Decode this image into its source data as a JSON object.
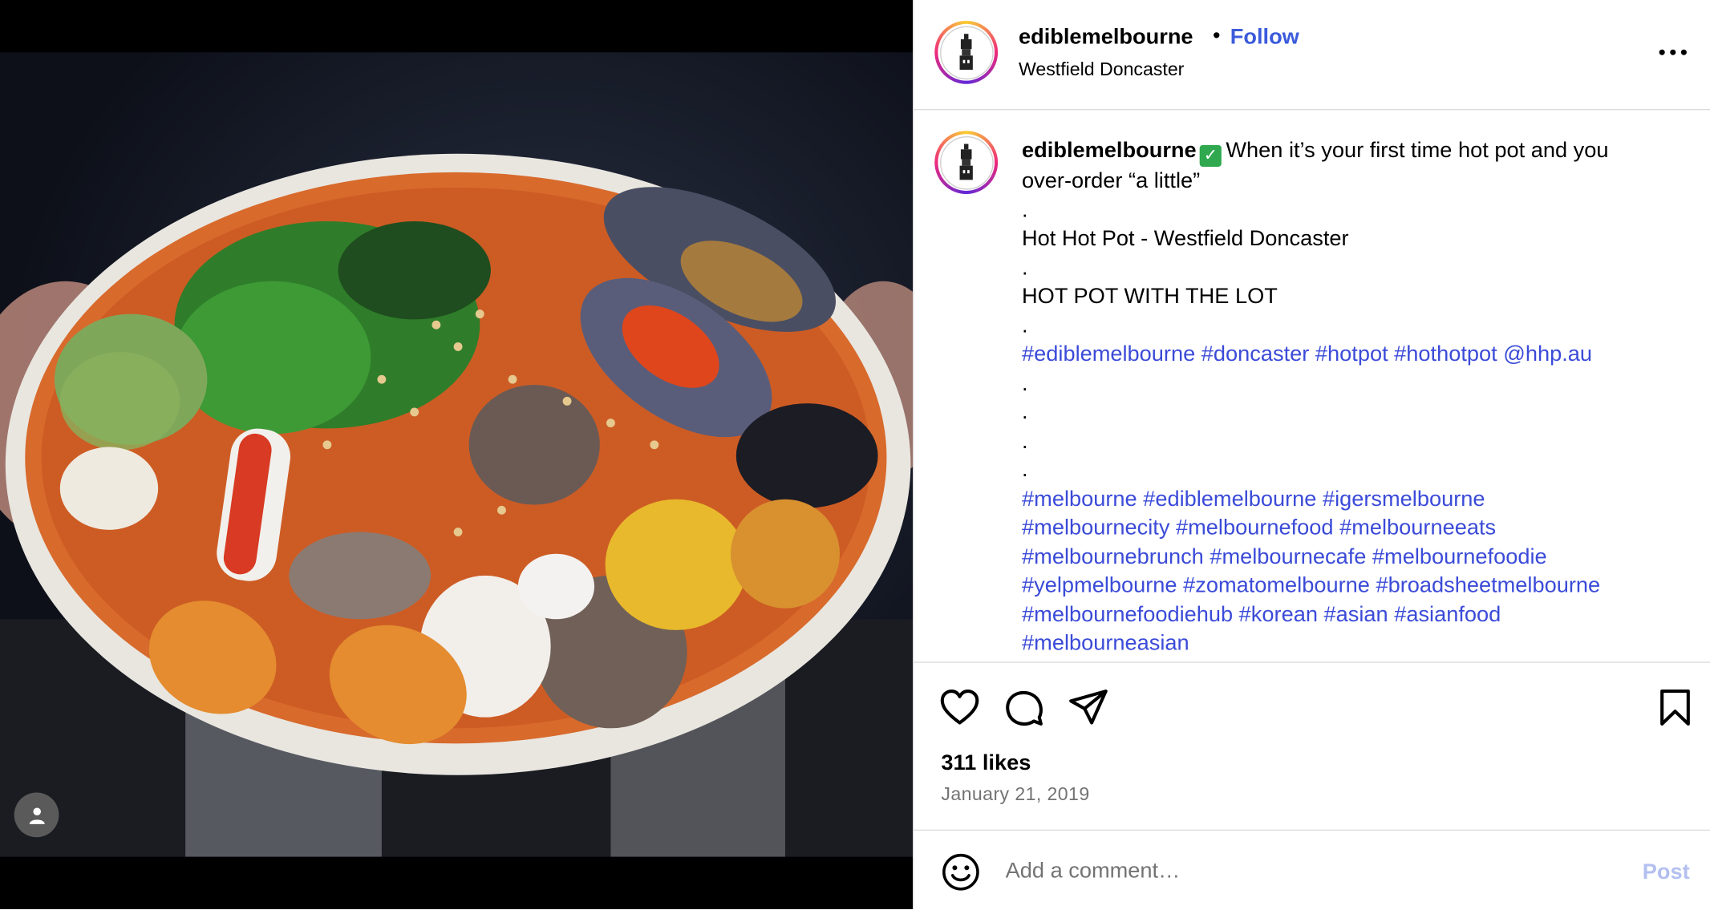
{
  "post": {
    "username": "ediblemelbourne",
    "follow_label": "Follow",
    "dot": "•",
    "location": "Westfield Doncaster",
    "more_icon": "more-horizontal-icon"
  },
  "caption": {
    "username": "ediblemelbourne",
    "verified_emoji": "✅",
    "line1": "When it’s your first time hot pot and you",
    "line2": "over-order “a little”",
    "dot1": ".",
    "line3": "Hot Hot Pot - Westfield Doncaster",
    "dot2": ".",
    "line4": "HOT POT WITH THE LOT",
    "dot3": ".",
    "tags1": "#ediblemelbourne #doncaster #hotpot #hothotpot @hhp.au",
    "dot4": ".",
    "dot5": ".",
    "dot6": ".",
    "dot7": ".",
    "hashtag_lines": [
      "#melbourne #ediblemelbourne #igersmelbourne",
      "#melbournecity #melbournefood #melbourneeats",
      "#melbournebrunch #melbournecafe #melbournefoodie",
      "#yelpmelbourne #zomatomelbourne #broadsheetmelbourne",
      "#melbournefoodiehub #korean #asian #asianfood",
      "#melbourneasian"
    ]
  },
  "stats": {
    "likes": "311 likes",
    "date": "January 21, 2019"
  },
  "comment": {
    "placeholder": "Add a comment…",
    "post_label": "Post"
  },
  "colors": {
    "link": "#3b4bd8",
    "follow": "#3b5bdb",
    "muted": "#737373",
    "border": "#dbdbdb",
    "post_disabled": "#b3bff0"
  }
}
